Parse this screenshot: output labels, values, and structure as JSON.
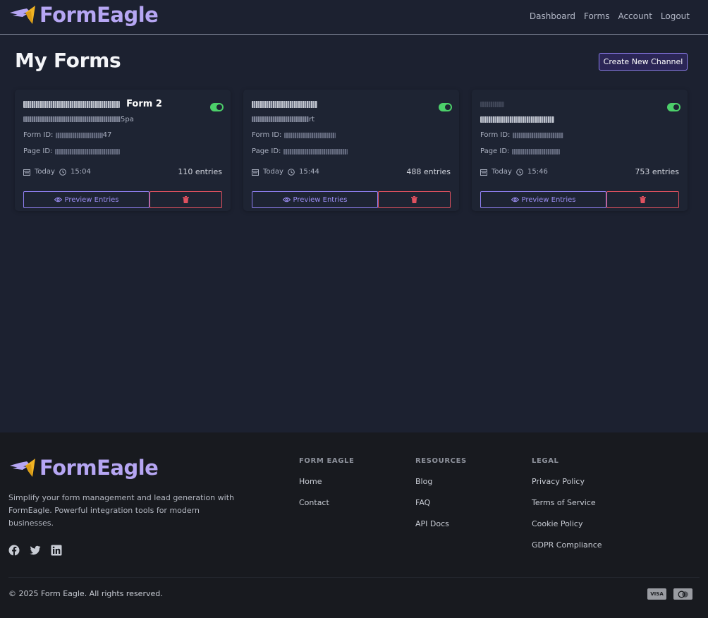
{
  "brand": {
    "name": "FormEagle",
    "accent": "#b6a6f3",
    "icon": "eagle-logo-icon"
  },
  "nav": [
    "Dashboard",
    "Forms",
    "Account",
    "Logout"
  ],
  "main": {
    "title": "My Forms",
    "create_button": "Create New Channel"
  },
  "cards": [
    {
      "title_suffix": "Form 2",
      "subtitle_suffix": "5pa",
      "form_id_label": "Form ID:",
      "form_id_suffix": "47",
      "page_id_label": "Page ID:",
      "date": "Today",
      "time": "15:04",
      "entries": "110 entries",
      "enabled": true,
      "preview_label": "Preview Entries"
    },
    {
      "title_suffix": "",
      "subtitle_suffix": "rt",
      "form_id_label": "Form ID:",
      "form_id_suffix": "",
      "page_id_label": "Page ID:",
      "date": "Today",
      "time": "15:44",
      "entries": "488 entries",
      "enabled": true,
      "preview_label": "Preview Entries"
    },
    {
      "title_suffix": "",
      "subtitle_suffix": "",
      "form_id_label": "Form ID:",
      "form_id_suffix": "",
      "page_id_label": "Page ID:",
      "date": "Today",
      "time": "15:46",
      "entries": "753 entries",
      "enabled": true,
      "preview_label": "Preview Entries"
    }
  ],
  "footer": {
    "description": "Simplify your form management and lead generation with FormEagle. Powerful integration tools for modern businesses.",
    "social_icons": [
      "facebook-icon",
      "twitter-icon",
      "linkedin-icon"
    ],
    "columns": [
      {
        "heading": "FORM EAGLE",
        "links": [
          "Home",
          "Contact"
        ]
      },
      {
        "heading": "RESOURCES",
        "links": [
          "Blog",
          "FAQ",
          "API Docs"
        ]
      },
      {
        "heading": "LEGAL",
        "links": [
          "Privacy Policy",
          "Terms of Service",
          "Cookie Policy",
          "GDPR Compliance"
        ]
      }
    ],
    "copyright": "© 2025 Form Eagle. All rights reserved.",
    "payment": [
      "VISA",
      "mastercard-icon"
    ]
  },
  "colors": {
    "background": "#1c2130",
    "footer": "#181a1f",
    "toggle_on": "#4ccf6a",
    "danger": "#e0515f",
    "primary": "#8f7ff0"
  }
}
